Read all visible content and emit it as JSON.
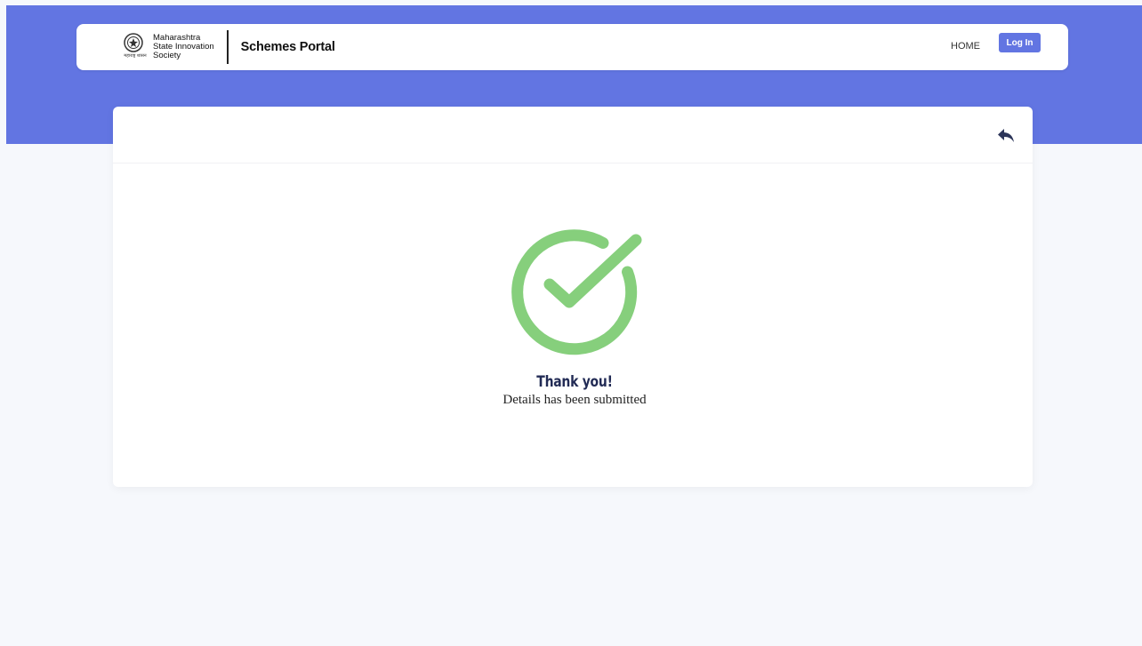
{
  "header": {
    "org_line1": "Maharashtra",
    "org_line2": "State Innovation",
    "org_line3": "Society",
    "emblem_script": "महाराष्ट्र शासन",
    "portal_title": "Schemes Portal",
    "nav_home": "HOME",
    "login_label": "Log In"
  },
  "card": {
    "back_icon": "reply-arrow-icon",
    "success_icon": "check-circle-icon",
    "title": "Thank you!",
    "subtitle": "Details has been submitted"
  },
  "colors": {
    "primary": "#6275e2",
    "success": "#86cf7c",
    "heading": "#222b55",
    "background": "#f6f8fc"
  }
}
